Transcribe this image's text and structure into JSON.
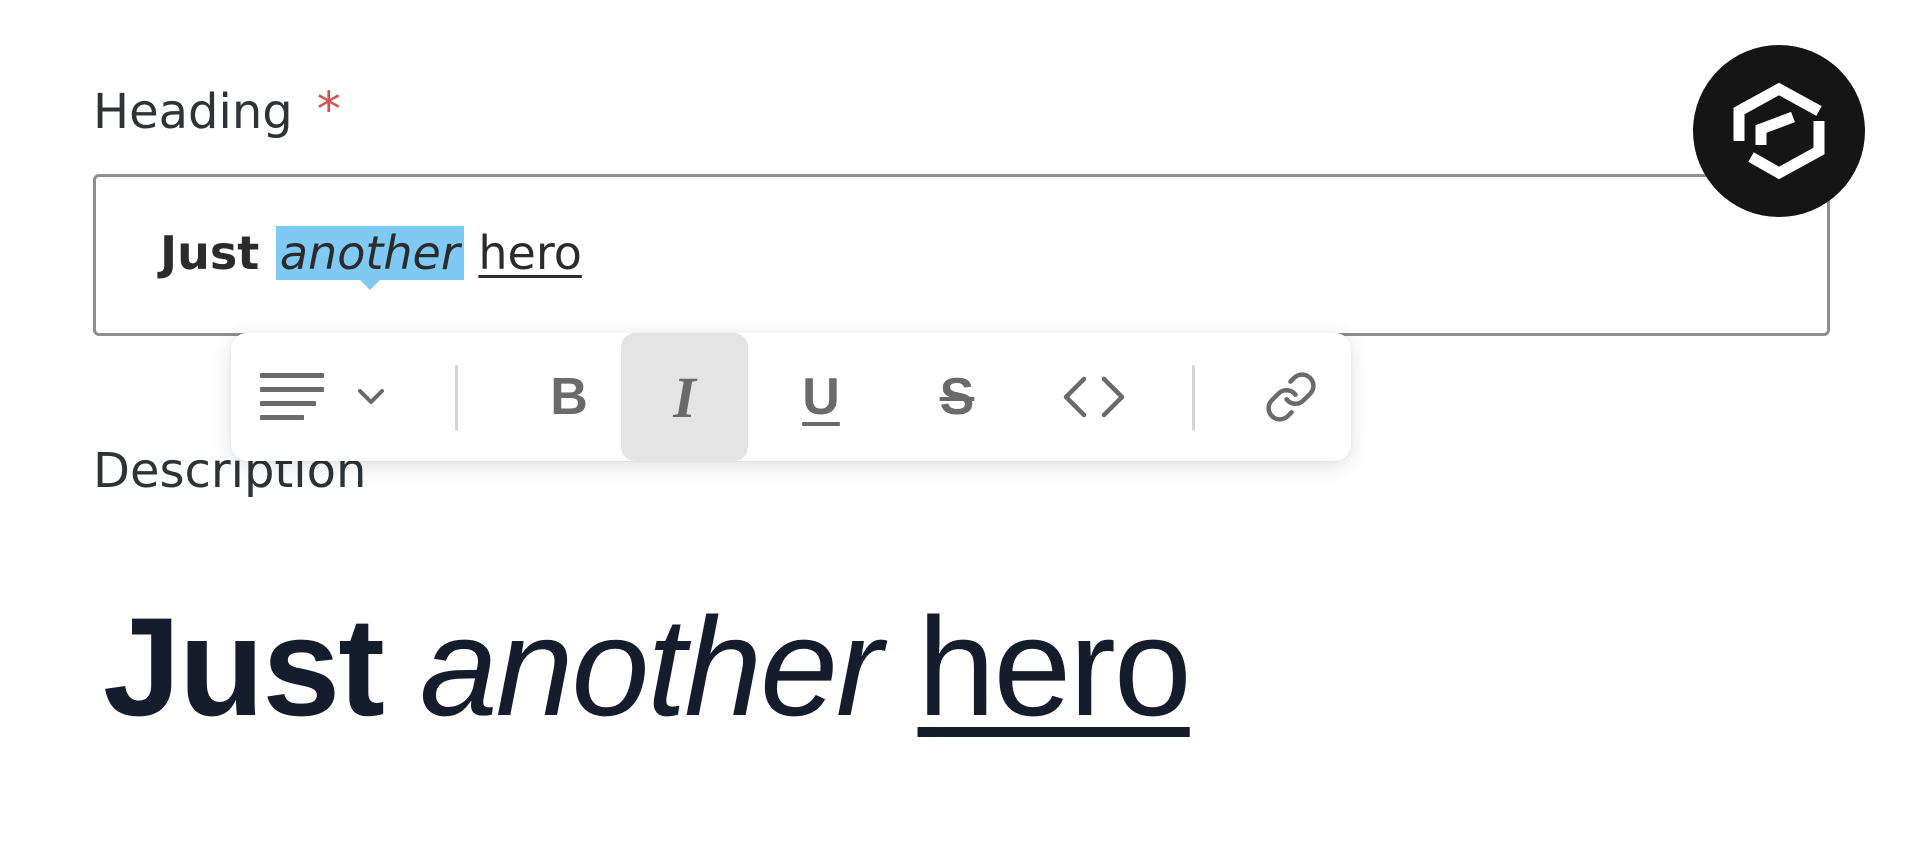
{
  "heading_field": {
    "label": "Heading",
    "required_marker": "*",
    "value_words": {
      "bold": "Just",
      "italic_selected": "another",
      "underlined": "hero"
    }
  },
  "description_field": {
    "label": "Description"
  },
  "toolbar": {
    "buttons": [
      {
        "name": "align",
        "icon": "align-left-icon"
      },
      {
        "name": "bold",
        "glyph": "B"
      },
      {
        "name": "italic",
        "glyph": "I",
        "active": true
      },
      {
        "name": "underline",
        "glyph": "U"
      },
      {
        "name": "strikethrough",
        "glyph": "S"
      },
      {
        "name": "code",
        "icon": "code-brackets-icon"
      },
      {
        "name": "link",
        "icon": "link-icon"
      }
    ]
  },
  "preview": {
    "bold": "Just",
    "italic": "another",
    "underlined": "hero"
  },
  "colors": {
    "selection": "#80c9f4",
    "required": "#d8514b",
    "toolbar_active": "#e4e4e4",
    "preview_text": "#151c2b",
    "badge": "#151515"
  }
}
